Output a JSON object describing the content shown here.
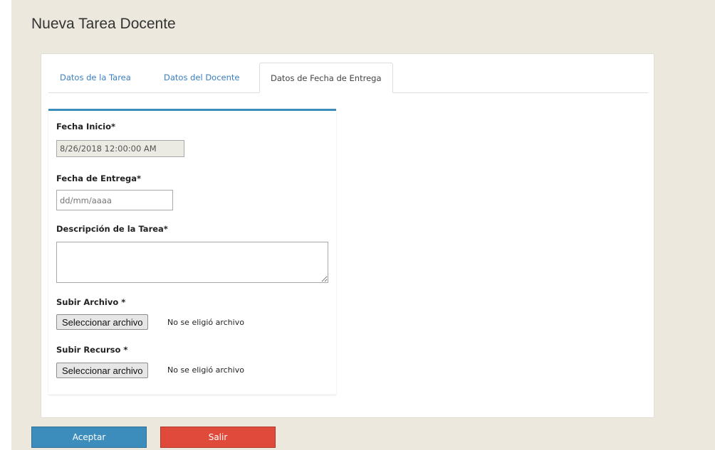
{
  "page": {
    "title": "Nueva Tarea Docente"
  },
  "tabs": [
    {
      "label": "Datos de la Tarea",
      "active": false
    },
    {
      "label": "Datos del Docente",
      "active": false
    },
    {
      "label": "Datos de Fecha de Entrega",
      "active": true
    }
  ],
  "form": {
    "start_date": {
      "label": "Fecha Inicio*",
      "value": "8/26/2018 12:00:00 AM",
      "readonly": true
    },
    "due_date": {
      "label": "Fecha de Entrega*",
      "placeholder": "dd/mm/aaaa",
      "value": ""
    },
    "description": {
      "label": "Descripción de la Tarea*",
      "value": ""
    },
    "upload_file": {
      "label": "Subir Archivo *",
      "button_label": "Seleccionar archivo",
      "status": "No se eligió archivo"
    },
    "upload_resource": {
      "label": "Subir Recurso *",
      "button_label": "Seleccionar archivo",
      "status": "No se eligió archivo"
    }
  },
  "actions": {
    "accept_label": "Aceptar",
    "exit_label": "Salir"
  },
  "colors": {
    "accent": "#3c8dbc",
    "danger": "#e04a3a",
    "background": "#ece8dd"
  }
}
